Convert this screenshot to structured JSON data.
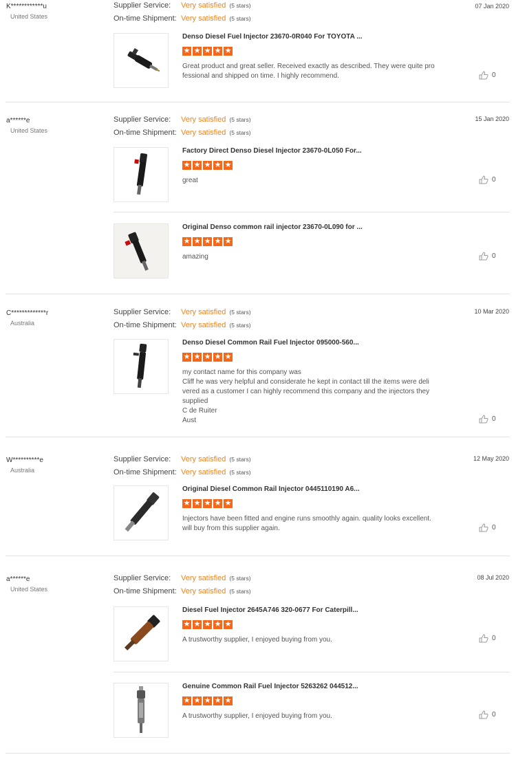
{
  "labels": {
    "supplier_service": "Supplier Service:",
    "on_time_shipment": "On-time Shipment:"
  },
  "colors": {
    "accent": "#f08318",
    "star": "#f5681a"
  },
  "reviews": [
    {
      "user": "K************u",
      "country": "United States",
      "date": "07 Jan 2020",
      "supplier_rating": "Very satisfied",
      "supplier_count": "(5 stars)",
      "shipment_rating": "Very satisfied",
      "shipment_count": "(5 stars)",
      "items": [
        {
          "title": "Denso Diesel Fuel Injector 23670-0R040 For TOYOTA ...",
          "stars": 5,
          "comment": "Great product and great seller. Received exactly as described. They were quite pro\nfessional and shipped on time. I highly recommend.",
          "likes": "0",
          "image": "injector-photo"
        }
      ]
    },
    {
      "user": "a******e",
      "country": "United States",
      "date": "15 Jan 2020",
      "supplier_rating": "Very satisfied",
      "supplier_count": "(5 stars)",
      "shipment_rating": "Very satisfied",
      "shipment_count": "(5 stars)",
      "items": [
        {
          "title": "Factory Direct Denso Diesel Injector 23670-0L050 For...",
          "stars": 5,
          "comment": "great",
          "likes": "0",
          "image": "injector-photo"
        },
        {
          "title": "Original Denso common rail injector 23670-0L090 for ...",
          "stars": 5,
          "comment": "amazing",
          "likes": "0",
          "image": "injector-photo"
        }
      ]
    },
    {
      "user": "C*************r",
      "country": "Australia",
      "date": "10 Mar 2020",
      "supplier_rating": "Very satisfied",
      "supplier_count": "(5 stars)",
      "shipment_rating": "Very satisfied",
      "shipment_count": "(5 stars)",
      "items": [
        {
          "title": "Denso Diesel Common Rail Fuel Injector 095000-560...",
          "stars": 5,
          "comment": "my contact name for this company was\nCliff he was very helpful and considerate he kept in contact till the items were deli\nvered as a customer I can highly recommend this company and the injectors they\nsupplied\nC de Ruiter\nAust",
          "likes": "0",
          "image": "injector-photo"
        }
      ]
    },
    {
      "user": "W**********e",
      "country": "Australia",
      "date": "12 May 2020",
      "supplier_rating": "Very satisfied",
      "supplier_count": "(5 stars)",
      "shipment_rating": "Very satisfied",
      "shipment_count": "(5 stars)",
      "items": [
        {
          "title": "Original Diesel Common Rail Injector 0445110190 A6...",
          "stars": 5,
          "comment": "Injectors have been fitted and engine runs smoothly again. quality looks excellent.\nwill buy from this supplier again.",
          "likes": "0",
          "image": "injector-photo"
        }
      ]
    },
    {
      "user": "a******e",
      "country": "United States",
      "date": "08 Jul 2020",
      "supplier_rating": "Very satisfied",
      "supplier_count": "(5 stars)",
      "shipment_rating": "Very satisfied",
      "shipment_count": "(5 stars)",
      "items": [
        {
          "title": "Diesel Fuel Injector 2645A746 320-0677 For Caterpill...",
          "stars": 5,
          "comment": "A trustworthy supplier, I enjoyed buying from you.",
          "likes": "0",
          "image": "injector-photo"
        },
        {
          "title": "Genuine Common Rail Fuel Injector 5263262 044512...",
          "stars": 5,
          "comment": "A trustworthy supplier, I enjoyed buying from you.",
          "likes": "0",
          "image": "injector-photo"
        }
      ]
    }
  ]
}
